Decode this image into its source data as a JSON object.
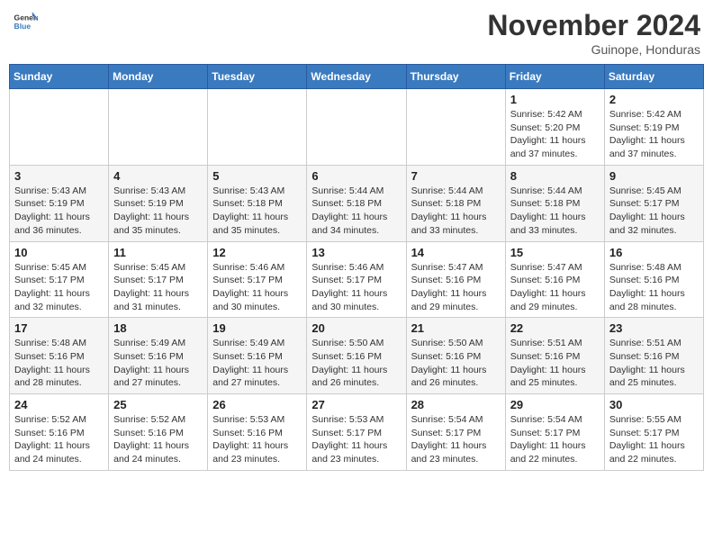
{
  "header": {
    "logo_general": "General",
    "logo_blue": "Blue",
    "month": "November 2024",
    "location": "Guinope, Honduras"
  },
  "days_of_week": [
    "Sunday",
    "Monday",
    "Tuesday",
    "Wednesday",
    "Thursday",
    "Friday",
    "Saturday"
  ],
  "weeks": [
    [
      {
        "day": "",
        "info": ""
      },
      {
        "day": "",
        "info": ""
      },
      {
        "day": "",
        "info": ""
      },
      {
        "day": "",
        "info": ""
      },
      {
        "day": "",
        "info": ""
      },
      {
        "day": "1",
        "info": "Sunrise: 5:42 AM\nSunset: 5:20 PM\nDaylight: 11 hours\nand 37 minutes."
      },
      {
        "day": "2",
        "info": "Sunrise: 5:42 AM\nSunset: 5:19 PM\nDaylight: 11 hours\nand 37 minutes."
      }
    ],
    [
      {
        "day": "3",
        "info": "Sunrise: 5:43 AM\nSunset: 5:19 PM\nDaylight: 11 hours\nand 36 minutes."
      },
      {
        "day": "4",
        "info": "Sunrise: 5:43 AM\nSunset: 5:19 PM\nDaylight: 11 hours\nand 35 minutes."
      },
      {
        "day": "5",
        "info": "Sunrise: 5:43 AM\nSunset: 5:18 PM\nDaylight: 11 hours\nand 35 minutes."
      },
      {
        "day": "6",
        "info": "Sunrise: 5:44 AM\nSunset: 5:18 PM\nDaylight: 11 hours\nand 34 minutes."
      },
      {
        "day": "7",
        "info": "Sunrise: 5:44 AM\nSunset: 5:18 PM\nDaylight: 11 hours\nand 33 minutes."
      },
      {
        "day": "8",
        "info": "Sunrise: 5:44 AM\nSunset: 5:18 PM\nDaylight: 11 hours\nand 33 minutes."
      },
      {
        "day": "9",
        "info": "Sunrise: 5:45 AM\nSunset: 5:17 PM\nDaylight: 11 hours\nand 32 minutes."
      }
    ],
    [
      {
        "day": "10",
        "info": "Sunrise: 5:45 AM\nSunset: 5:17 PM\nDaylight: 11 hours\nand 32 minutes."
      },
      {
        "day": "11",
        "info": "Sunrise: 5:45 AM\nSunset: 5:17 PM\nDaylight: 11 hours\nand 31 minutes."
      },
      {
        "day": "12",
        "info": "Sunrise: 5:46 AM\nSunset: 5:17 PM\nDaylight: 11 hours\nand 30 minutes."
      },
      {
        "day": "13",
        "info": "Sunrise: 5:46 AM\nSunset: 5:17 PM\nDaylight: 11 hours\nand 30 minutes."
      },
      {
        "day": "14",
        "info": "Sunrise: 5:47 AM\nSunset: 5:16 PM\nDaylight: 11 hours\nand 29 minutes."
      },
      {
        "day": "15",
        "info": "Sunrise: 5:47 AM\nSunset: 5:16 PM\nDaylight: 11 hours\nand 29 minutes."
      },
      {
        "day": "16",
        "info": "Sunrise: 5:48 AM\nSunset: 5:16 PM\nDaylight: 11 hours\nand 28 minutes."
      }
    ],
    [
      {
        "day": "17",
        "info": "Sunrise: 5:48 AM\nSunset: 5:16 PM\nDaylight: 11 hours\nand 28 minutes."
      },
      {
        "day": "18",
        "info": "Sunrise: 5:49 AM\nSunset: 5:16 PM\nDaylight: 11 hours\nand 27 minutes."
      },
      {
        "day": "19",
        "info": "Sunrise: 5:49 AM\nSunset: 5:16 PM\nDaylight: 11 hours\nand 27 minutes."
      },
      {
        "day": "20",
        "info": "Sunrise: 5:50 AM\nSunset: 5:16 PM\nDaylight: 11 hours\nand 26 minutes."
      },
      {
        "day": "21",
        "info": "Sunrise: 5:50 AM\nSunset: 5:16 PM\nDaylight: 11 hours\nand 26 minutes."
      },
      {
        "day": "22",
        "info": "Sunrise: 5:51 AM\nSunset: 5:16 PM\nDaylight: 11 hours\nand 25 minutes."
      },
      {
        "day": "23",
        "info": "Sunrise: 5:51 AM\nSunset: 5:16 PM\nDaylight: 11 hours\nand 25 minutes."
      }
    ],
    [
      {
        "day": "24",
        "info": "Sunrise: 5:52 AM\nSunset: 5:16 PM\nDaylight: 11 hours\nand 24 minutes."
      },
      {
        "day": "25",
        "info": "Sunrise: 5:52 AM\nSunset: 5:16 PM\nDaylight: 11 hours\nand 24 minutes."
      },
      {
        "day": "26",
        "info": "Sunrise: 5:53 AM\nSunset: 5:16 PM\nDaylight: 11 hours\nand 23 minutes."
      },
      {
        "day": "27",
        "info": "Sunrise: 5:53 AM\nSunset: 5:17 PM\nDaylight: 11 hours\nand 23 minutes."
      },
      {
        "day": "28",
        "info": "Sunrise: 5:54 AM\nSunset: 5:17 PM\nDaylight: 11 hours\nand 23 minutes."
      },
      {
        "day": "29",
        "info": "Sunrise: 5:54 AM\nSunset: 5:17 PM\nDaylight: 11 hours\nand 22 minutes."
      },
      {
        "day": "30",
        "info": "Sunrise: 5:55 AM\nSunset: 5:17 PM\nDaylight: 11 hours\nand 22 minutes."
      }
    ]
  ]
}
